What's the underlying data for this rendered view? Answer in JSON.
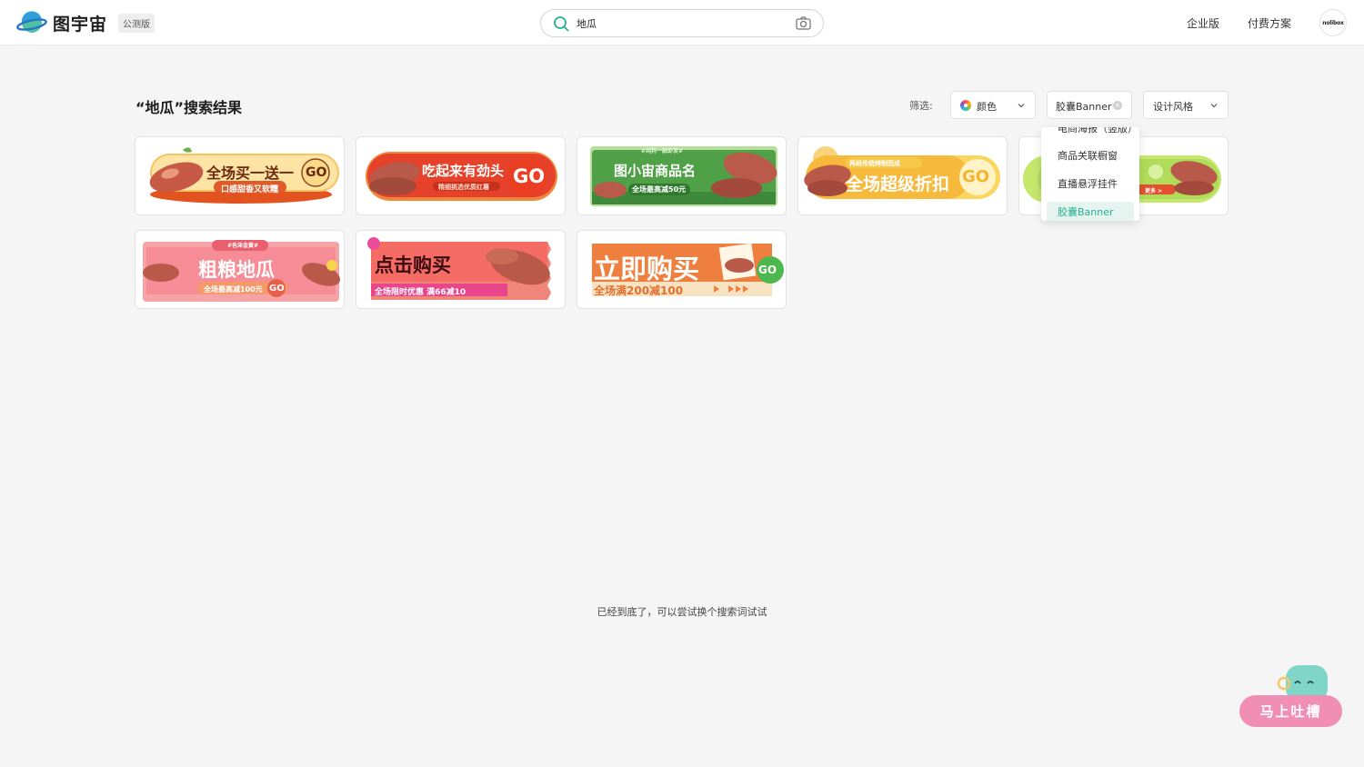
{
  "header": {
    "logo_name": "图宇宙",
    "beta_label": "公测版",
    "search_value": "地瓜",
    "nav": [
      "企业版",
      "付费方案"
    ],
    "avatar_text": "nolibox"
  },
  "page": {
    "title": "“地瓜”搜索结果",
    "end_text": "已经到底了，可以尝试换个搜索词试试"
  },
  "filters": {
    "label": "筛选:",
    "color_label": "颜色",
    "type_label": "胶囊Banner",
    "style_label": "设计风格"
  },
  "dropdown": {
    "items": [
      "电商海报（竖版）",
      "商品关联橱窗",
      "直播悬浮挂件",
      "胶囊Banner"
    ],
    "selected": "胶囊Banner"
  },
  "results": [
    {
      "headline": "全场买一送一",
      "sub": "口感甜香又软糯",
      "go": "GO"
    },
    {
      "headline": "吃起来有劲头",
      "sub": "精细挑选优质红薯",
      "go": "GO"
    },
    {
      "headline": "图小宙商品名",
      "sub": "全场最高减50元",
      "tag": "#纯狗一触即发#"
    },
    {
      "headline": "全场超级折扣",
      "sub": "再经传统烤制而成",
      "go": "GO"
    },
    {
      "headline": "",
      "sub": "更多 >"
    },
    {
      "headline": "粗粮地瓜",
      "sub": "全场最高减100元",
      "tag": "#色泽金黄#",
      "go": "GO"
    },
    {
      "headline": "点击购买",
      "sub": "全场限时优惠 满66减10"
    },
    {
      "headline": "立即购买",
      "sub": "全场满200减100",
      "go": "GO"
    }
  ],
  "feedback": {
    "label": "马上吐槽"
  },
  "colors": {
    "accent": "#26b08f",
    "feedback": "#f08fb3"
  }
}
